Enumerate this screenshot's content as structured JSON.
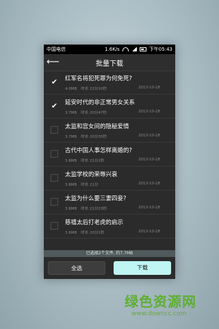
{
  "status_bar": {
    "carrier": "中国电信",
    "speed": "1.6K/s",
    "time": "下午05:43"
  },
  "header": {
    "title": "批量下载"
  },
  "items": [
    {
      "title": "红军名将犯死罪为何免死?",
      "size": "4.0MB",
      "duration": "时长 22分10秒",
      "date": "2013-10-28",
      "checked": true
    },
    {
      "title": "延安时代的非正常男女关系",
      "size": "3.7MB",
      "duration": "时长 20分47秒",
      "date": "2013-10-28",
      "checked": true
    },
    {
      "title": "太监和宫女间的隐秘爱情",
      "size": "3.7MB",
      "duration": "时长 20分35秒",
      "date": "2013-10-28",
      "checked": false
    },
    {
      "title": "古代中国人事怎样离婚的?",
      "size": "3.8MB",
      "duration": "时长 21分2秒",
      "date": "2013-10-28",
      "checked": false
    },
    {
      "title": "太监学校的荣辱兴衰",
      "size": "3.8MB",
      "duration": "时长 21分",
      "date": "2013-10-28",
      "checked": false
    },
    {
      "title": "太监为什么要三妻四妾?",
      "size": "3.8MB",
      "duration": "时长 21分23秒",
      "date": "2013-10-28",
      "checked": false
    },
    {
      "title": "慈禧太后打老虎的启示",
      "size": "3.6MB",
      "duration": "时长 20分1秒",
      "date": "2013-10-28",
      "checked": false
    }
  ],
  "selection_text": "已选择2个文件, 约7.7MB",
  "buttons": {
    "select_all": "全选",
    "download": "下载"
  },
  "watermark": {
    "line1": "绿色资源网",
    "line2": "www.downcc.com"
  }
}
